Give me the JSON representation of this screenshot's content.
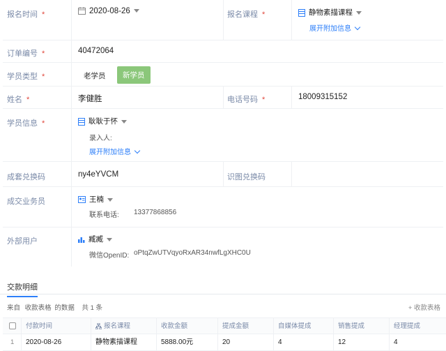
{
  "form": {
    "signup_time": {
      "label": "报名时间",
      "value": "2020-08-26"
    },
    "signup_course": {
      "label": "报名课程",
      "value": "静物素描课程",
      "expand": "展开附加信息"
    },
    "order_no": {
      "label": "订单编号",
      "value": "40472064"
    },
    "student_type": {
      "label": "学员类型",
      "options": [
        "老学员",
        "新学员"
      ],
      "selected": "新学员"
    },
    "name": {
      "label": "姓名",
      "value": "李健胜"
    },
    "phone": {
      "label": "电话号码",
      "value": "18009315152"
    },
    "student_info": {
      "label": "学员信息",
      "value": "耿耿于怀",
      "sub_label": "录入人:",
      "expand": "展开附加信息"
    },
    "set_code": {
      "label": "成套兑换码",
      "value": "ny4eYVCM"
    },
    "image_code": {
      "label": "识图兑换码",
      "value": ""
    },
    "salesperson": {
      "label": "成交业务员",
      "value": "王楠",
      "contact_label": "联系电话:",
      "contact_value": "13377868856"
    },
    "external_user": {
      "label": "外部用户",
      "value": "臧臧",
      "openid_label": "微信OpenID:",
      "openid_value": "oPtqZwUTVqyoRxAR34nwfLgXHC0U"
    },
    "required_mark": "*"
  },
  "tabs": {
    "active": "交款明细"
  },
  "table_meta": {
    "from_label": "来自",
    "source": "收款表格",
    "suffix": "的数据",
    "count": "共 1 条",
    "add": "+ 收款表格"
  },
  "table": {
    "headers": [
      "付款时间",
      "报名课程",
      "收款金额",
      "提成金额",
      "自媒体提成",
      "销售提成",
      "经理提成"
    ],
    "rows": [
      {
        "num": "1",
        "cells": [
          "2020-08-26",
          "静物素描课程",
          "5888.00元",
          "20",
          "4",
          "12",
          "4"
        ]
      }
    ]
  },
  "colors": {
    "accent": "#2d7ff9",
    "required": "#e0463b",
    "label": "#7a8aa8",
    "selected_tag": "#8bc77a"
  }
}
